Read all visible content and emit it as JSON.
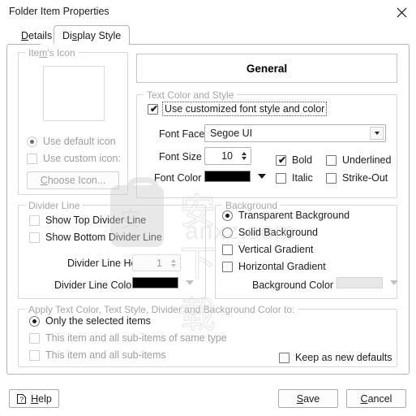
{
  "window": {
    "title": "Folder Item Properties",
    "close_icon": "close-icon"
  },
  "tabs": [
    {
      "label": "Details",
      "accel": "D",
      "active": false
    },
    {
      "label": "Display Style",
      "accel": "s",
      "active": true
    }
  ],
  "item_icon_group": {
    "title": "Item's Icon",
    "enabled": false,
    "use_default_icon": {
      "label": "Use default icon",
      "checked": true
    },
    "use_custom_icon": {
      "label": "Use custom icon:",
      "checked": false
    },
    "choose_icon_button": "Choose Icon..."
  },
  "divider_group": {
    "title": "Divider Line",
    "enabled": false,
    "show_top": {
      "label": "Show Top Divider Line",
      "checked": false
    },
    "show_bottom": {
      "label": "Show Bottom Divider Line",
      "checked": false
    },
    "height_label": "Divider Line Height",
    "height_value": "1",
    "color_label": "Divider Line Color",
    "color_value": "#000000"
  },
  "preview": {
    "text": "General"
  },
  "text_style_group": {
    "title": "Text Color and Style",
    "use_custom": {
      "label": "Use customized font style and color",
      "checked": true,
      "focused": true
    },
    "font_face_label": "Font Face",
    "font_face_value": "Segoe UI",
    "font_size_label": "Font Size",
    "font_size_value": "10",
    "font_color_label": "Font Color",
    "font_color_value": "#000000",
    "bold": {
      "label": "Bold",
      "checked": true
    },
    "italic": {
      "label": "Italic",
      "checked": false
    },
    "underlined": {
      "label": "Underlined",
      "checked": false
    },
    "strikeout": {
      "label": "Strike-Out",
      "checked": false
    }
  },
  "background_group": {
    "title": "Background",
    "transparent": {
      "label": "Transparent Background",
      "checked": true
    },
    "solid": {
      "label": "Solid Background",
      "checked": false
    },
    "vertical_gradient": {
      "label": "Vertical Gradient",
      "checked": false
    },
    "horizontal_gradient": {
      "label": "Horizontal Gradient",
      "checked": false
    },
    "bg_color_label": "Background Color",
    "bg_color_value": "#e8e8e8"
  },
  "apply_group": {
    "title": "Apply Text Color, Text Style, Divider and Background Color to:",
    "only_selected": {
      "label": "Only the selected items",
      "checked": true,
      "enabled": true
    },
    "same_type": {
      "label": "This item and all sub-items of same type",
      "checked": false,
      "enabled": false
    },
    "all_sub": {
      "label": "This item and all sub-items",
      "checked": false,
      "enabled": false
    },
    "keep_defaults": {
      "label": "Keep as new defaults",
      "checked": false
    }
  },
  "footer": {
    "help_label": "Help",
    "help_accel": "H",
    "help_icon": "help-question-icon",
    "save_label": "Save",
    "save_accel": "S",
    "cancel_label": "Cancel",
    "cancel_accel": "C"
  },
  "watermark": {
    "chinese": "安",
    "outline_text": "安下载",
    "url": "anxz.com"
  }
}
